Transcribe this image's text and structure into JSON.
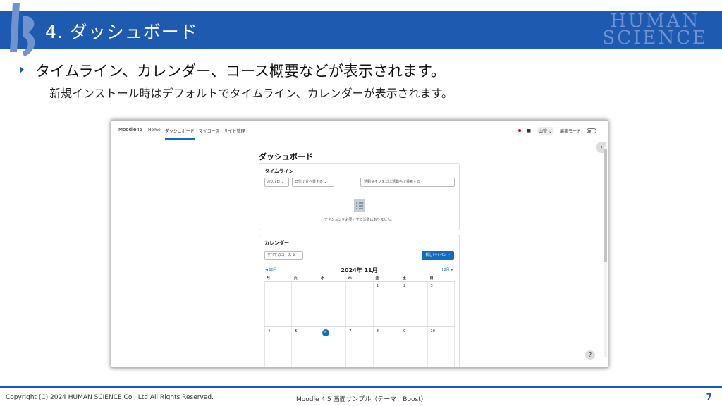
{
  "slide": {
    "title": "4. ダッシュボード",
    "brand_line1": "HUMAN",
    "brand_line2": "SCIENCE",
    "bullet_text": "タイムライン、カレンダー、コース概要などが表示されます。",
    "sub_text": "新規インストール時はデフォルトでタイムライン、カレンダーが表示されます。"
  },
  "moodle": {
    "site_name": "Moodle45",
    "nav": [
      "Home",
      "ダッシュボード",
      "マイコース",
      "サイト管理"
    ],
    "active_nav": "ダッシュボード",
    "user_label": "山管",
    "edit_mode_label": "編集モード",
    "page_title": "ダッシュボード",
    "timeline": {
      "heading": "タイムライン",
      "filter_days": "次の7日",
      "sort": "日付で並べ替える",
      "search_placeholder": "活動タイプまたは活動名で検索する",
      "empty_text": "アクションを必要とする活動はありません。"
    },
    "calendar": {
      "heading": "カレンダー",
      "course_filter": "すべてのコース",
      "new_event": "新しいイベント",
      "prev": "◄ 10月",
      "next": "12月 ►",
      "month": "2024年 11月",
      "days_of_week": [
        "月",
        "火",
        "水",
        "木",
        "金",
        "土",
        "日"
      ],
      "weeks": [
        [
          "",
          "",
          "",
          "",
          "1",
          "2",
          "3"
        ],
        [
          "4",
          "5",
          "6",
          "7",
          "8",
          "9",
          "10"
        ]
      ],
      "today": "6"
    },
    "help": "?"
  },
  "footer": {
    "copyright": "Copyright (C) 2024 HUMAN SCIENCE Co., Ltd All Rights Reserved.",
    "subtitle": "Moodle 4.5 画面サンプル（テーマ：Boost）",
    "page": "7"
  },
  "colors": {
    "header_blue": "#1e5bb0",
    "moodle_blue": "#0f6cbf"
  }
}
